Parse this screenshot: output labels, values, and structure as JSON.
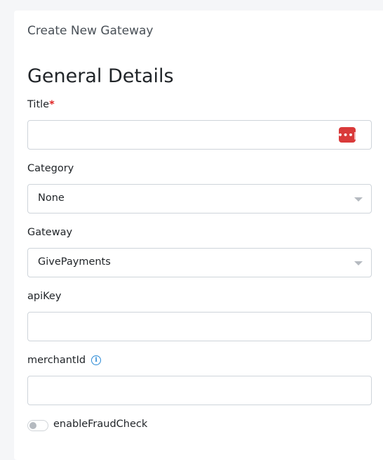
{
  "page": {
    "card_title": "Create New Gateway",
    "section_title": "General Details"
  },
  "form": {
    "title": {
      "label": "Title",
      "required_mark": "*",
      "value": "",
      "password_manager_icon": "password-manager-icon",
      "password_manager_glyph": "•••|"
    },
    "category": {
      "label": "Category",
      "selected": "None"
    },
    "gateway": {
      "label": "Gateway",
      "selected": "GivePayments"
    },
    "api_key": {
      "label": "apiKey",
      "value": ""
    },
    "merchant_id": {
      "label": "merchantId",
      "info_icon": "info-icon",
      "info_glyph": "i",
      "value": ""
    },
    "enable_fraud_check": {
      "label": "enableFraudCheck",
      "enabled": false
    }
  },
  "colors": {
    "required": "#e02424",
    "password_icon_bg": "#d93a3a",
    "info_icon": "#2b8ad6"
  }
}
